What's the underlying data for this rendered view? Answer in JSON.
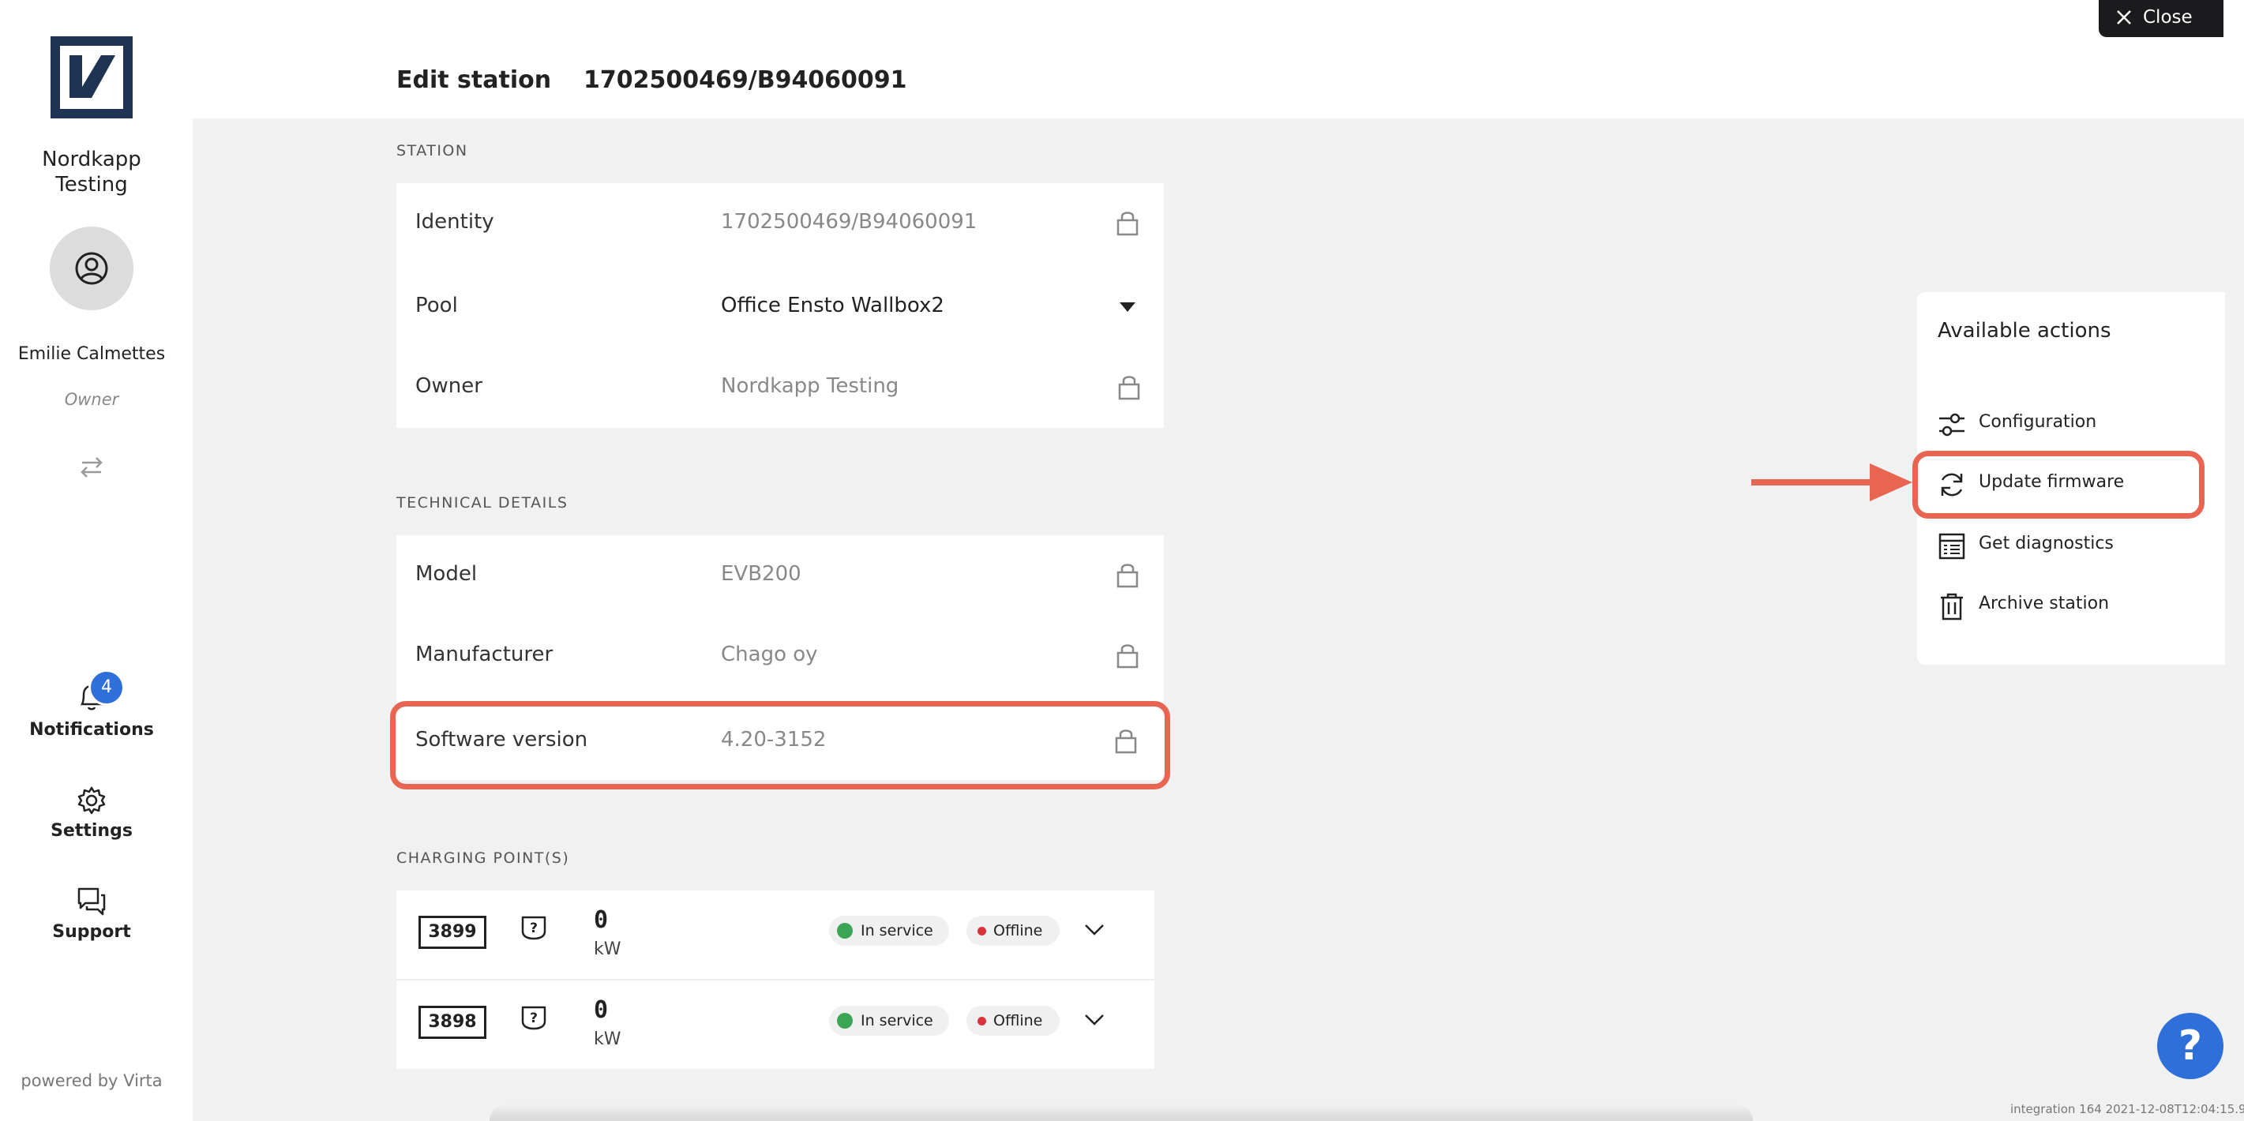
{
  "sidebar": {
    "org_name_line1": "Nordkapp",
    "org_name_line2": "Testing",
    "user_name": "Emilie Calmettes",
    "user_role": "Owner",
    "notifications_label": "Notifications",
    "notifications_count": "4",
    "settings_label": "Settings",
    "support_label": "Support",
    "powered_by": "powered by Virta"
  },
  "header": {
    "title": "Edit station",
    "station_id": "1702500469/B94060091",
    "close_label": "Close"
  },
  "station": {
    "section_label": "STATION",
    "identity_label": "Identity",
    "identity_value": "1702500469/B94060091",
    "pool_label": "Pool",
    "pool_value": "Office Ensto Wallbox2",
    "owner_label": "Owner",
    "owner_value": "Nordkapp Testing"
  },
  "technical": {
    "section_label": "TECHNICAL DETAILS",
    "model_label": "Model",
    "model_value": "EVB200",
    "manufacturer_label": "Manufacturer",
    "manufacturer_value": "Chago oy",
    "software_label": "Software version",
    "software_value": "4.20-3152"
  },
  "charging": {
    "section_label": "CHARGING POINT(S)",
    "points": [
      {
        "id": "3899",
        "power": "0",
        "unit": "kW",
        "status": "In service",
        "connection": "Offline"
      },
      {
        "id": "3898",
        "power": "0",
        "unit": "kW",
        "status": "In service",
        "connection": "Offline"
      }
    ]
  },
  "actions": {
    "title": "Available actions",
    "items": [
      {
        "label": "Configuration",
        "icon": "sliders-icon"
      },
      {
        "label": "Update firmware",
        "icon": "refresh-icon"
      },
      {
        "label": "Get diagnostics",
        "icon": "diagnostics-icon"
      },
      {
        "label": "Archive station",
        "icon": "trash-icon"
      }
    ]
  },
  "help_label": "?",
  "footer_version": "integration 164 2021-12-08T12:04:15.9",
  "colors": {
    "highlight": "#e86651",
    "accent": "#2f6fd9",
    "in_service": "#3aa655",
    "offline": "#d9343a"
  }
}
